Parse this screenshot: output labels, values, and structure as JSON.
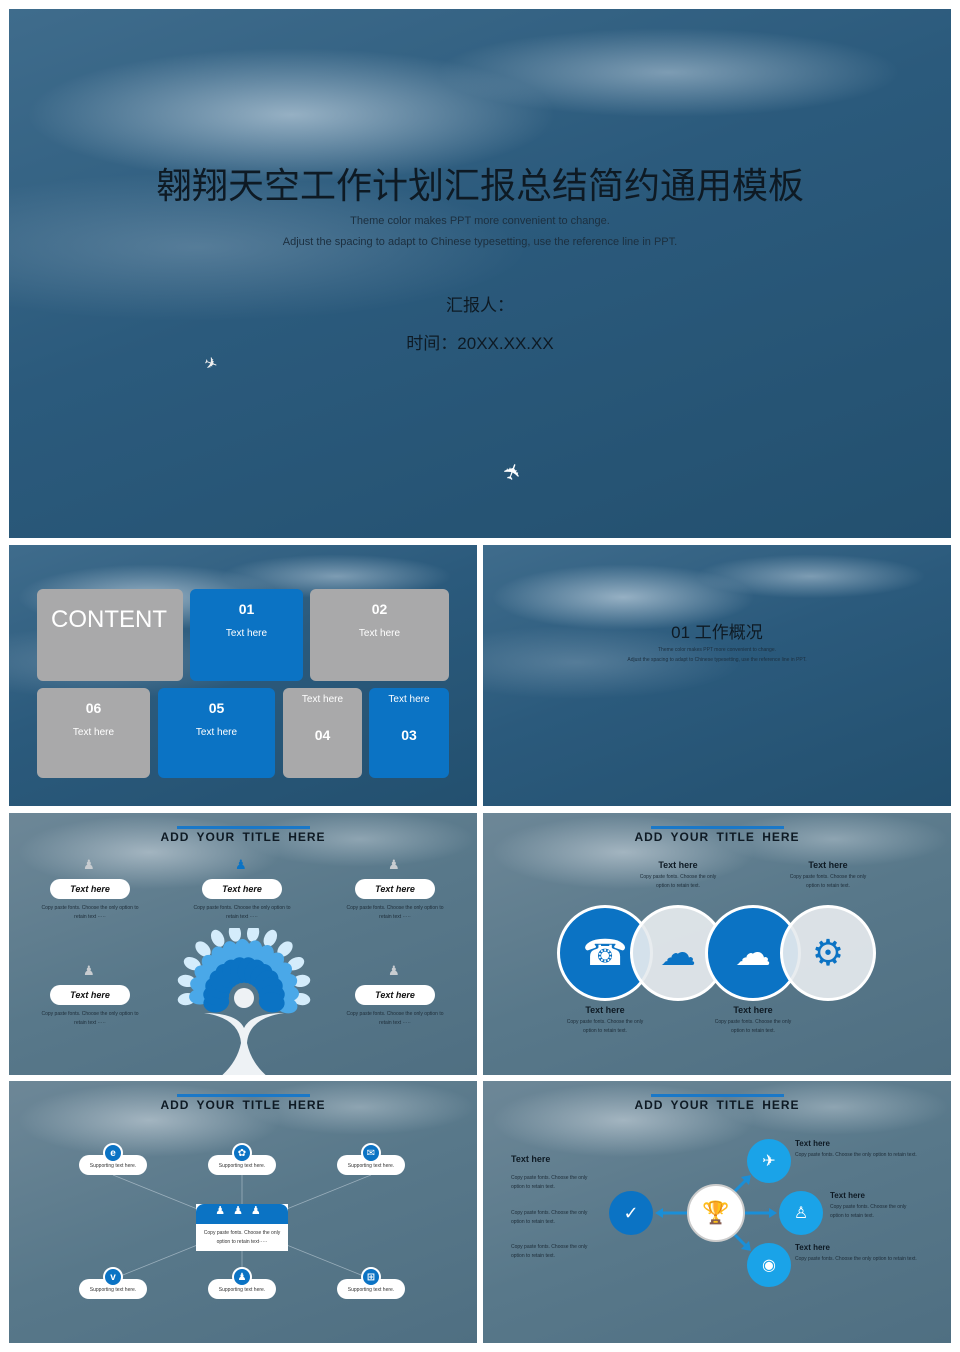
{
  "colors": {
    "accent_blue": "#0b73c4",
    "light_blue": "#1aa3e8",
    "box_gray": "#a9a9aa"
  },
  "cover": {
    "title": "翱翔天空工作计划汇报总结简约通用模板",
    "subtitle_line1": "Theme color makes PPT more convenient to change.",
    "subtitle_line2": "Adjust the spacing to adapt to Chinese typesetting, use the reference line in PPT.",
    "reporter": "汇报人：",
    "date": "时间：20XX.XX.XX"
  },
  "contents": {
    "heading": "CONTENT",
    "items": [
      {
        "num": "01",
        "label": "Text here"
      },
      {
        "num": "02",
        "label": "Text here"
      },
      {
        "num": "03",
        "label": "Text here"
      },
      {
        "num": "04",
        "label": "Text here"
      },
      {
        "num": "05",
        "label": "Text here"
      },
      {
        "num": "06",
        "label": "Text here"
      }
    ]
  },
  "section": {
    "title": "01  工作概况",
    "line1": "Theme color makes PPT more convenient to change.",
    "line2": "Adjust the spacing to adapt to Chinese typesetting, use the reference line in PPT."
  },
  "tree_slide": {
    "title": "ADD  YOUR  TITLE  HERE",
    "items": [
      {
        "label": "Text here",
        "desc": "Copy paste fonts. Choose the only option to retain text ·····",
        "icon": "user-gear-icon"
      },
      {
        "label": "Text here",
        "desc": "Copy paste fonts. Choose the only option to retain text ·····",
        "icon": "user-gear-icon"
      },
      {
        "label": "Text here",
        "desc": "Copy paste fonts. Choose the only option to retain text ·····",
        "icon": "user-gear-icon"
      },
      {
        "label": "Text here",
        "desc": "Copy paste fonts. Choose the only option to retain text ·····",
        "icon": "user-gear-icon"
      },
      {
        "label": "Text here",
        "desc": "Copy paste fonts. Choose the only option to retain text ·····",
        "icon": "user-gear-icon"
      }
    ]
  },
  "circles_slide": {
    "title": "ADD  YOUR  TITLE  HERE",
    "items": [
      {
        "label": "Text here",
        "desc": "Copy paste fonts. Choose the only option to retain text.",
        "icon": "phone-support-icon"
      },
      {
        "label": "Text here",
        "desc": "Copy paste fonts. Choose the only option to retain text.",
        "icon": "cloud-signal-icon"
      },
      {
        "label": "Text here",
        "desc": "Copy paste fonts. Choose the only option to retain text.",
        "icon": "cloud-network-icon"
      },
      {
        "label": "Text here",
        "desc": "Copy paste fonts. Choose the only option to retain text.",
        "icon": "gear-icon"
      }
    ]
  },
  "network_slide": {
    "title": "ADD  YOUR  TITLE  HERE",
    "center_text": "Copy paste fonts. Choose the only option to retain text·····",
    "nodes": [
      {
        "label": "Supporting text here.",
        "icon": "ie-icon",
        "glyph": "e"
      },
      {
        "label": "Supporting text here.",
        "icon": "paw-icon",
        "glyph": "✿"
      },
      {
        "label": "Supporting text here.",
        "icon": "wechat-icon",
        "glyph": "✉"
      },
      {
        "label": "Supporting text here.",
        "icon": "vimeo-icon",
        "glyph": "v"
      },
      {
        "label": "Supporting text here.",
        "icon": "qq-icon",
        "glyph": "♟"
      },
      {
        "label": "Supporting text here.",
        "icon": "windows-icon",
        "glyph": "⊞"
      }
    ]
  },
  "arrows_slide": {
    "title": "ADD  YOUR  TITLE  HERE",
    "left": {
      "heading": "Text here",
      "paras": [
        "Copy paste fonts. Choose the only option to retain text.",
        "Copy paste fonts. Choose the only option to retain text.",
        "Copy paste fonts. Choose the only option to retain text."
      ]
    },
    "right": [
      {
        "heading": "Text here",
        "desc": "Copy paste fonts. Choose the only option to retain text.",
        "icon": "airplane-icon",
        "glyph": "✈"
      },
      {
        "heading": "Text here",
        "desc": "Copy paste fonts. Choose the only option to retain text.",
        "icon": "user-icon",
        "glyph": "♙"
      },
      {
        "heading": "Text here",
        "desc": "Copy paste fonts. Choose the only option to retain text.",
        "icon": "eye-icon",
        "glyph": "◉"
      }
    ],
    "center_icon": "trophy-icon",
    "left_icon": "checkmark-icon"
  }
}
